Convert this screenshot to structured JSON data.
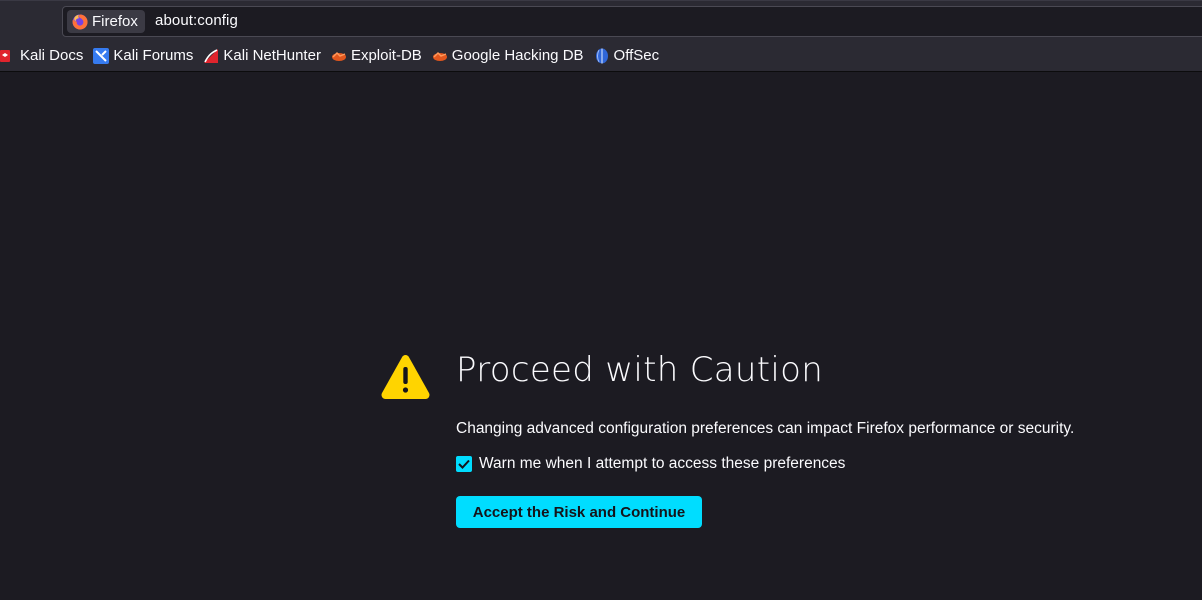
{
  "urlbar": {
    "identity_label": "Firefox",
    "url": "about:config"
  },
  "bookmarks": [
    {
      "label": "Kali Docs",
      "icon": "kali-docs-icon"
    },
    {
      "label": "Kali Forums",
      "icon": "kali-forums-icon"
    },
    {
      "label": "Kali NetHunter",
      "icon": "kali-nethunter-icon"
    },
    {
      "label": "Exploit-DB",
      "icon": "exploit-db-icon"
    },
    {
      "label": "Google Hacking DB",
      "icon": "ghdb-icon"
    },
    {
      "label": "OffSec",
      "icon": "offsec-icon"
    }
  ],
  "warning": {
    "title": "Proceed with Caution",
    "description": "Changing advanced configuration preferences can impact Firefox performance or security.",
    "checkbox_label": "Warn me when I attempt to access these preferences",
    "checkbox_checked": true,
    "button_label": "Accept the Risk and Continue"
  },
  "colors": {
    "accent": "#00ddff",
    "warning_icon": "#ffd400",
    "background": "#1c1b22",
    "toolbar": "#2b2a33"
  }
}
